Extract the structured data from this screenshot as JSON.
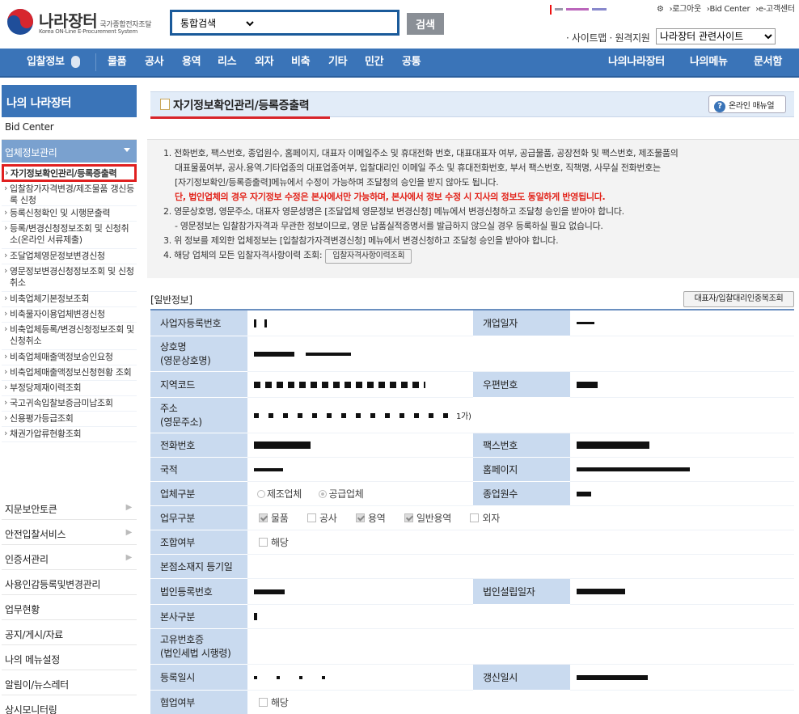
{
  "header": {
    "logo_title": "나라장터",
    "logo_title_sub": "국가종합전자조달",
    "logo_subtitle": "Korea ON-Line E-Procurement System",
    "search_select": "통합검색",
    "search_button": "검색",
    "util_links": [
      "›로그아웃",
      "›Bid Center",
      "›e-고객센터"
    ],
    "sitemap": "· 사이트맵 · 원격지원",
    "related_sites": "나라장터 관련사이트"
  },
  "nav": {
    "items": [
      "입찰정보",
      "물품",
      "공사",
      "용역",
      "리스",
      "외자",
      "비축",
      "기타",
      "민간",
      "공통"
    ],
    "right_items": [
      "나의나라장터",
      "나의메뉴",
      "문서함"
    ]
  },
  "sidebar": {
    "title": "나의 나라장터",
    "bid_center": "Bid Center",
    "group": "업체정보관리",
    "sub_items": [
      "자기정보확인관리/등록증출력",
      "입찰참가자격변경/제조물품 갱신등록 신청",
      "등록신청확인 및 시행문출력",
      "등록/변경신청정보조회 및 신청취소(온라인 서류제출)",
      "조달업체영문정보변경신청",
      "영문정보변경신청정보조회 및 신청취소",
      "비축업체기본정보조회",
      "비축물자이용업체변경신청",
      "비축업체등록/변경신청정보조회 및 신청취소",
      "비축업체매출액정보승인요청",
      "비축업체매출액정보신청현황 조회",
      "부정당제재이력조회",
      "국고귀속입찰보증금미납조회",
      "신용평가등급조회",
      "채권가압류현황조회"
    ],
    "main_items": [
      "지문보안토큰",
      "안전입찰서비스",
      "인증서관리",
      "사용인감등록및변경관리",
      "업무현황",
      "공지/게시/자료",
      "나의 메뉴설정",
      "알림이/뉴스레터",
      "상시모니터링"
    ]
  },
  "page": {
    "title": "자기정보확인관리/등록증출력",
    "manual_button": "온라인 매뉴얼",
    "notice": {
      "line1": "1. 전화번호, 팩스번호, 종업원수, 홈페이지, 대표자 이메일주소 및 휴대전화 번호, 대표대표자 여부, 공급물품, 공장전화 및 팩스번호, 제조물품의",
      "line1b": "대표물품여부, 공사.용역.기타업종의 대표업종여부, 입찰대리인 이메일 주소 및 휴대전화번호, 부서 팩스번호, 직책명, 사무실 전화번호는",
      "line1c": "[자기정보확인/등록증출력]메뉴에서 수정이 가능하며 조달청의 승인을 받지 않아도 됩니다.",
      "line1d": "단, 법인업체의 경우 자기정보 수정은 본사에서만 가능하며, 본사에서 정보 수정 시 지사의 정보도 동일하게 반영됩니다.",
      "line2": "2. 영문상호명, 영문주소, 대표자 영문성명은 [조달업체 영문정보 변경신청] 메뉴에서 변경신청하고 조달청 승인을 받아야 합니다.",
      "line2b": "- 영문정보는 입찰참가자격과 무관한 정보이므로, 영문 납품실적증명서를 발급하지 않으실 경우 등록하실 필요 없습니다.",
      "line3": "3. 위 정보를 제외한 업체정보는 [입찰참가자격변경신청] 메뉴에서 변경신청하고 조달청 승인을 받아야 합니다.",
      "line4": "4. 해당 업체의 모든 입찰자격사항이력 조회:",
      "history_button": "입찰자격사항이력조회"
    },
    "section_label": "[일반정보]",
    "rep_button": "대표자/입찰대리인중복조회",
    "labels": {
      "bizno": "사업자등록번호",
      "open_date": "개업일자",
      "name": "상호명",
      "name_en": "(영문상호명)",
      "region": "지역코드",
      "zip": "우편번호",
      "addr": "주소",
      "addr_en": "(영문주소)",
      "tel": "전화번호",
      "fax": "팩스번호",
      "nation": "국적",
      "homepage": "홈페이지",
      "biz_type": "업체구분",
      "employees": "종업원수",
      "work_type": "업무구분",
      "union": "조합여부",
      "hq_reg": "본점소재지 등기일",
      "corp_no": "법인등록번호",
      "corp_date": "법인설립일자",
      "hq_div": "본사구분",
      "unique_no": "고유번호증",
      "unique_no_sub": "(법인세법 시행령)",
      "reg_date": "등록일시",
      "renew_date": "갱신일시",
      "assoc": "협업여부"
    },
    "values": {
      "addr_tail": "1가)",
      "biz_type_opts": [
        "제조업체",
        "공급업체"
      ],
      "work_type_opts": [
        "물품",
        "공사",
        "용역",
        "일반용역",
        "외자"
      ],
      "applicable": "해당"
    }
  }
}
